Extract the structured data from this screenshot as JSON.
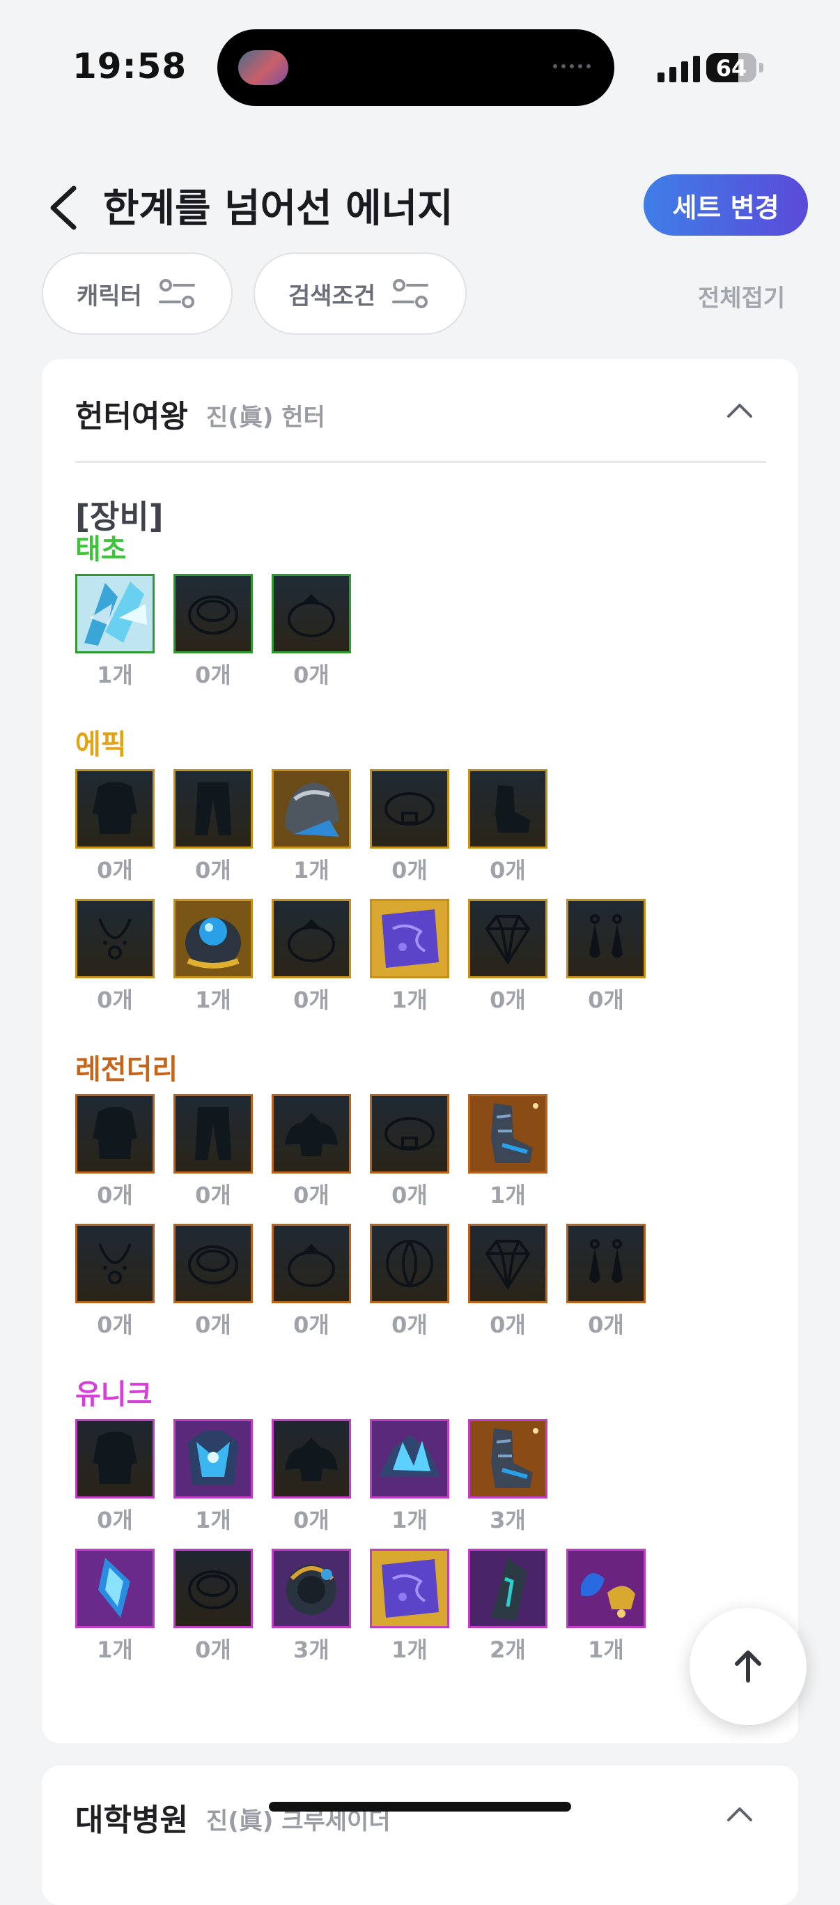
{
  "status": {
    "time": "19:58",
    "battery": "64",
    "battery_level": 0.64
  },
  "header": {
    "title": "한계를 넘어선 에너지",
    "set_button": "세트 변경"
  },
  "filters": {
    "character": "캐릭터",
    "search": "검색조건",
    "collapse_all": "전체접기"
  },
  "section": {
    "title": "헌터여왕",
    "subtitle": "진(眞) 헌터",
    "category": "[장비]",
    "grades": [
      {
        "label": "태초",
        "color": "#3ec43a",
        "border": "#2f9a2d",
        "bg": "#1f2c37",
        "rows": [
          [
            {
              "icon": "crystal-blade-icon",
              "count": "1개",
              "owned": true
            },
            {
              "icon": "bracelet-icon",
              "count": "0개",
              "owned": false
            },
            {
              "icon": "ring-icon",
              "count": "0개",
              "owned": false
            }
          ]
        ]
      },
      {
        "label": "에픽",
        "color": "#e0a416",
        "border": "#c7901a",
        "bg": "#1f2a33",
        "rows": [
          [
            {
              "icon": "top-armor-icon",
              "count": "0개",
              "owned": false
            },
            {
              "icon": "pants-icon",
              "count": "0개",
              "owned": false
            },
            {
              "icon": "shoulder-armor-icon",
              "count": "1개",
              "owned": true
            },
            {
              "icon": "belt-icon",
              "count": "0개",
              "owned": false
            },
            {
              "icon": "boots-icon",
              "count": "0개",
              "owned": false
            }
          ],
          [
            {
              "icon": "necklace-icon",
              "count": "0개",
              "owned": false
            },
            {
              "icon": "bracelet-gem-icon",
              "count": "1개",
              "owned": true
            },
            {
              "icon": "ring-icon",
              "count": "0개",
              "owned": false
            },
            {
              "icon": "purple-rune-icon",
              "count": "1개",
              "owned": true
            },
            {
              "icon": "gem-icon",
              "count": "0개",
              "owned": false
            },
            {
              "icon": "earring-icon",
              "count": "0개",
              "owned": false
            }
          ]
        ]
      },
      {
        "label": "레전더리",
        "color": "#c6651a",
        "border": "#b8641e",
        "bg": "#1f2933",
        "rows": [
          [
            {
              "icon": "top-armor-icon",
              "count": "0개",
              "owned": false
            },
            {
              "icon": "pants-icon",
              "count": "0개",
              "owned": false
            },
            {
              "icon": "shoulder-icon",
              "count": "0개",
              "owned": false
            },
            {
              "icon": "belt-icon",
              "count": "0개",
              "owned": false
            },
            {
              "icon": "armored-boots-icon",
              "count": "1개",
              "owned": true
            }
          ],
          [
            {
              "icon": "necklace-icon",
              "count": "0개",
              "owned": false
            },
            {
              "icon": "bracelet-icon",
              "count": "0개",
              "owned": false
            },
            {
              "icon": "ring-icon",
              "count": "0개",
              "owned": false
            },
            {
              "icon": "support-orb-icon",
              "count": "0개",
              "owned": false
            },
            {
              "icon": "gem-icon",
              "count": "0개",
              "owned": false
            },
            {
              "icon": "earring-icon",
              "count": "0개",
              "owned": false
            }
          ]
        ]
      },
      {
        "label": "유니크",
        "color": "#d63ed8",
        "border": "#c23ec6",
        "bg": "#1f2630",
        "rows": [
          [
            {
              "icon": "top-armor-icon",
              "count": "0개",
              "owned": false
            },
            {
              "icon": "crystal-armor-icon",
              "count": "1개",
              "owned": true
            },
            {
              "icon": "shoulder-icon",
              "count": "0개",
              "owned": false
            },
            {
              "icon": "crystal-shoulder-icon",
              "count": "1개",
              "owned": true
            },
            {
              "icon": "armored-boots-icon",
              "count": "3개",
              "owned": true
            }
          ],
          [
            {
              "icon": "crystal-necklace-icon",
              "count": "1개",
              "owned": true
            },
            {
              "icon": "bracelet-icon",
              "count": "0개",
              "owned": false
            },
            {
              "icon": "dark-ring-icon",
              "count": "3개",
              "owned": true
            },
            {
              "icon": "purple-rune-icon",
              "count": "1개",
              "owned": true
            },
            {
              "icon": "dark-gem-icon",
              "count": "2개",
              "owned": true
            },
            {
              "icon": "bell-earring-icon",
              "count": "1개",
              "owned": true
            }
          ]
        ]
      }
    ]
  },
  "next_section": {
    "title": "대학병원",
    "subtitle": "진(眞) 크루세이더"
  }
}
